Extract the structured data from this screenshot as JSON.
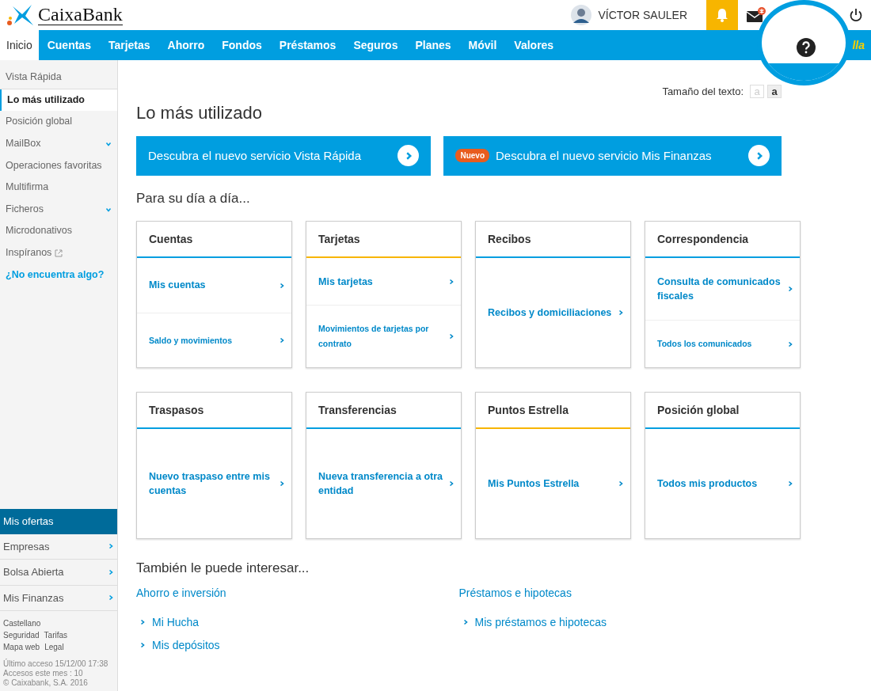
{
  "header": {
    "brand": "CaixaBank",
    "user_name": "VÍCTOR SAULER",
    "notifications_active": true,
    "mail_unread": true
  },
  "nav": {
    "tabs": [
      {
        "label": "Inicio",
        "selected": true
      },
      {
        "label": "Cuentas",
        "selected": false
      },
      {
        "label": "Tarjetas",
        "selected": false
      },
      {
        "label": "Ahorro",
        "selected": false
      },
      {
        "label": "Fondos",
        "selected": false
      },
      {
        "label": "Préstamos",
        "selected": false
      },
      {
        "label": "Seguros",
        "selected": false
      },
      {
        "label": "Planes",
        "selected": false
      },
      {
        "label": "Móvil",
        "selected": false
      },
      {
        "label": "Valores",
        "selected": false
      }
    ],
    "right_text": "lla"
  },
  "sidebar": {
    "items": [
      {
        "label": "Vista Rápida",
        "kind": "plain",
        "selected": false
      },
      {
        "label": "Lo más utilizado",
        "kind": "plain",
        "selected": true
      },
      {
        "label": "Posición global",
        "kind": "plain",
        "selected": false
      },
      {
        "label": "MailBox",
        "kind": "submenu",
        "selected": false
      },
      {
        "label": "Operaciones favoritas",
        "kind": "plain",
        "selected": false
      },
      {
        "label": "Multifirma",
        "kind": "plain",
        "selected": false
      },
      {
        "label": "Ficheros",
        "kind": "submenu",
        "selected": false
      },
      {
        "label": "Microdonativos",
        "kind": "plain",
        "selected": false
      },
      {
        "label": "Inspíranos",
        "kind": "external",
        "selected": false
      },
      {
        "label": "¿No encuentra algo?",
        "kind": "help",
        "selected": false
      }
    ],
    "offers_title": "Mis ofertas",
    "offers": [
      "Empresas",
      "Bolsa Abierta",
      "Mis Finanzas"
    ],
    "footer_links": [
      "Castellano",
      "Seguridad",
      "Tarifas",
      "Mapa web",
      "Legal"
    ],
    "info": [
      "Último acceso 15/12/00 17:38",
      "Accesos este mes : 10",
      "© Caixabank, S.A. 2016"
    ]
  },
  "text_size": {
    "label": "Tamaño del texto:",
    "options": [
      {
        "label": "a",
        "selected": false
      },
      {
        "label": "a",
        "selected": true
      }
    ]
  },
  "page_title": "Lo más utilizado",
  "banners": [
    {
      "text": "Descubra el nuevo servicio Vista Rápida"
    },
    {
      "badge": "Nuevo",
      "text": "Descubra el nuevo servicio Mis Finanzas"
    }
  ],
  "daily_title": "Para su día a día...",
  "cards": [
    {
      "title": "Cuentas",
      "color": "#009ee0",
      "links": [
        {
          "text": "Mis cuentas",
          "kind": "primary"
        },
        {
          "text": "Saldo y movimientos",
          "kind": "secondary"
        }
      ]
    },
    {
      "title": "Tarjetas",
      "color": "#f7b500",
      "links": [
        {
          "text": "Mis tarjetas",
          "kind": "primary"
        },
        {
          "text": "Movimientos de tarjetas por contrato",
          "kind": "secondary"
        }
      ]
    },
    {
      "title": "Recibos",
      "color": "#009ee0",
      "links": [
        {
          "text": "Recibos y domiciliaciones",
          "kind": "primary"
        }
      ]
    },
    {
      "title": "Correspondencia",
      "color": "#009ee0",
      "links": [
        {
          "text": "Consulta de comunicados fiscales",
          "kind": "primary"
        },
        {
          "text": "Todos los comunicados",
          "kind": "secondary"
        }
      ]
    },
    {
      "title": "Traspasos",
      "color": "#009ee0",
      "links": [
        {
          "text": "Nuevo traspaso entre mis cuentas",
          "kind": "primary"
        }
      ]
    },
    {
      "title": "Transferencias",
      "color": "#009ee0",
      "links": [
        {
          "text": "Nueva transferencia a otra entidad",
          "kind": "primary"
        }
      ]
    },
    {
      "title": "Puntos Estrella",
      "color": "#f7b500",
      "links": [
        {
          "text": "Mis Puntos Estrella",
          "kind": "primary"
        }
      ]
    },
    {
      "title": "Posición global",
      "color": "#009ee0",
      "links": [
        {
          "text": "Todos mis productos",
          "kind": "primary"
        }
      ]
    }
  ],
  "interest_title": "También le puede interesar...",
  "interest": [
    {
      "heading": "Ahorro e inversión",
      "links": [
        "Mi Hucha",
        "Mis depósitos"
      ]
    },
    {
      "heading": "Préstamos e hipotecas",
      "links": [
        "Mis préstamos e hipotecas"
      ]
    }
  ]
}
